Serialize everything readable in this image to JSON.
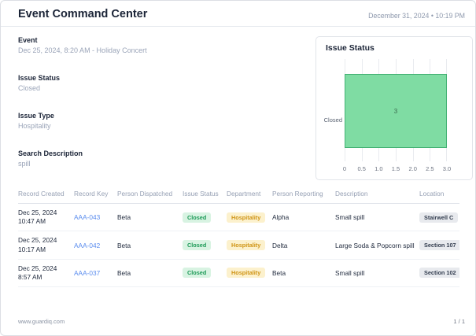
{
  "header": {
    "title": "Event Command Center",
    "datetime": "December 31, 2024 • 10:19 PM"
  },
  "fields": [
    {
      "label": "Event",
      "value": "Dec 25, 2024, 8:20 AM - Holiday Concert"
    },
    {
      "label": "Issue Status",
      "value": "Closed"
    },
    {
      "label": "Issue Type",
      "value": "Hospitality"
    },
    {
      "label": "Search Description",
      "value": "spill"
    }
  ],
  "chart_data": {
    "type": "bar",
    "orientation": "horizontal",
    "title": "Issue Status",
    "categories": [
      "Closed"
    ],
    "values": [
      3
    ],
    "xlabel": "",
    "ylabel": "",
    "xlim": [
      0,
      3.0
    ],
    "xticks": [
      "0",
      "0.5",
      "1.0",
      "1.5",
      "2.0",
      "2.5",
      "3.0"
    ],
    "grid": "vertical",
    "legend": "none",
    "bar_fill": "#7fdca3",
    "bar_border": "#44b274"
  },
  "table": {
    "columns": [
      "Record Created",
      "Record Key",
      "Person Dispatched",
      "Issue Status",
      "Department",
      "Person Reporting",
      "Description",
      "Location"
    ],
    "rows": [
      {
        "created_date": "Dec 25, 2024",
        "created_time": "10:47 AM",
        "key": "AAA-043",
        "dispatched": "Beta",
        "status": "Closed",
        "department": "Hospitality",
        "reporting": "Alpha",
        "description": "Small spill",
        "location": "Stairwell C"
      },
      {
        "created_date": "Dec 25, 2024",
        "created_time": "10:17 AM",
        "key": "AAA-042",
        "dispatched": "Beta",
        "status": "Closed",
        "department": "Hospitality",
        "reporting": "Delta",
        "description": "Large Soda & Popcorn spill",
        "location": "Section 107"
      },
      {
        "created_date": "Dec 25, 2024",
        "created_time": "8:57 AM",
        "key": "AAA-037",
        "dispatched": "Beta",
        "status": "Closed",
        "department": "Hospitality",
        "reporting": "Beta",
        "description": "Small spill",
        "location": "Section 102"
      }
    ]
  },
  "footer": {
    "url": "www.guardiq.com",
    "page": "1 / 1"
  },
  "colors": {
    "title_text": "#1b2437",
    "muted_text": "#9aa4b8",
    "link_blue": "#5a8cee",
    "status_badge_bg": "#d8f3e2",
    "status_badge_text": "#1c9a57",
    "dept_badge_bg": "#fcf1cd",
    "dept_badge_text": "#cf9415",
    "loc_badge_bg": "#e8eaee",
    "loc_badge_text": "#333d4f",
    "bar_fill": "#7fdca3",
    "bar_border": "#44b274"
  }
}
